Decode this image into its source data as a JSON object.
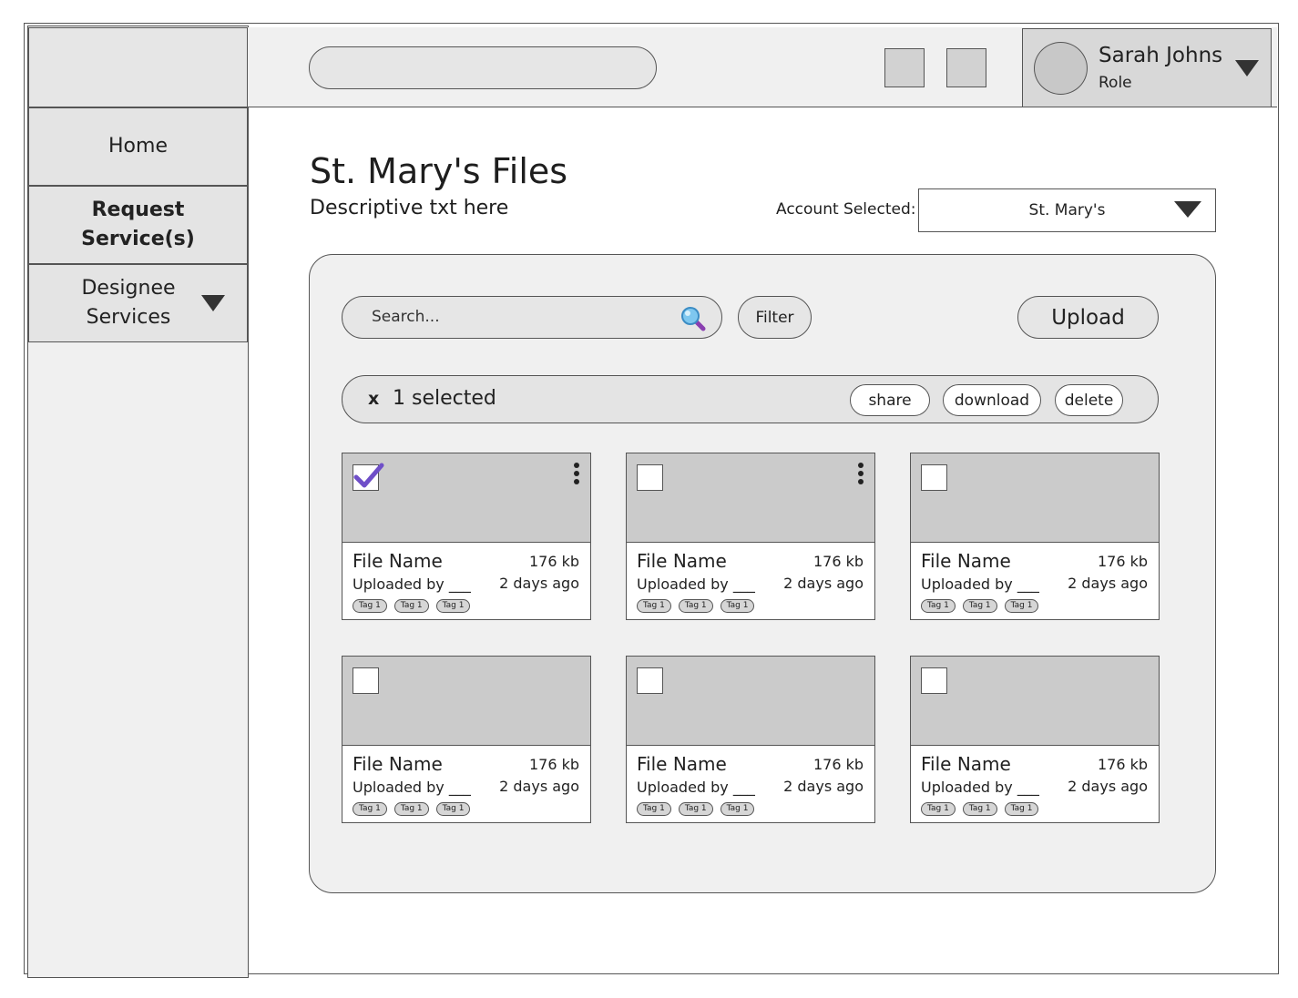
{
  "sidebar": {
    "items": [
      {
        "label": "Home"
      },
      {
        "label": "Request Service(s)"
      },
      {
        "label": "Designee Services"
      }
    ]
  },
  "header": {
    "search_value": "",
    "user": {
      "name": "Sarah Johns",
      "role": "Role"
    }
  },
  "page": {
    "title": "St. Mary's Files",
    "description": "Descriptive txt here",
    "account_label": "Account Selected:",
    "account_value": "St. Mary's"
  },
  "toolbar": {
    "search_placeholder": "Search...",
    "filter_label": "Filter",
    "upload_label": "Upload"
  },
  "selection": {
    "close_label": "x",
    "count_label": "1 selected",
    "share_label": "share",
    "download_label": "download",
    "delete_label": "delete"
  },
  "files": [
    {
      "name": "File Name",
      "size": "176 kb",
      "uploaded_by": "Uploaded by ___",
      "age": "2 days ago",
      "tags": [
        "Tag 1",
        "Tag 1",
        "Tag 1"
      ],
      "checked": true,
      "menu": true
    },
    {
      "name": "File Name",
      "size": "176 kb",
      "uploaded_by": "Uploaded by ___",
      "age": "2 days ago",
      "tags": [
        "Tag 1",
        "Tag 1",
        "Tag 1"
      ],
      "checked": false,
      "menu": true
    },
    {
      "name": "File Name",
      "size": "176 kb",
      "uploaded_by": "Uploaded by ___",
      "age": "2 days ago",
      "tags": [
        "Tag 1",
        "Tag 1",
        "Tag 1"
      ],
      "checked": false,
      "menu": false
    },
    {
      "name": "File Name",
      "size": "176 kb",
      "uploaded_by": "Uploaded by ___",
      "age": "2 days ago",
      "tags": [
        "Tag 1",
        "Tag 1",
        "Tag 1"
      ],
      "checked": false,
      "menu": false
    },
    {
      "name": "File Name",
      "size": "176 kb",
      "uploaded_by": "Uploaded by ___",
      "age": "2 days ago",
      "tags": [
        "Tag 1",
        "Tag 1",
        "Tag 1"
      ],
      "checked": false,
      "menu": false
    },
    {
      "name": "File Name",
      "size": "176 kb",
      "uploaded_by": "Uploaded by ___",
      "age": "2 days ago",
      "tags": [
        "Tag 1",
        "Tag 1",
        "Tag 1"
      ],
      "checked": false,
      "menu": false
    }
  ],
  "colors": {
    "checkmark": "#6f4fc8",
    "search_icon_lens": "#4aa3df",
    "search_icon_handle": "#8a3fb0"
  }
}
